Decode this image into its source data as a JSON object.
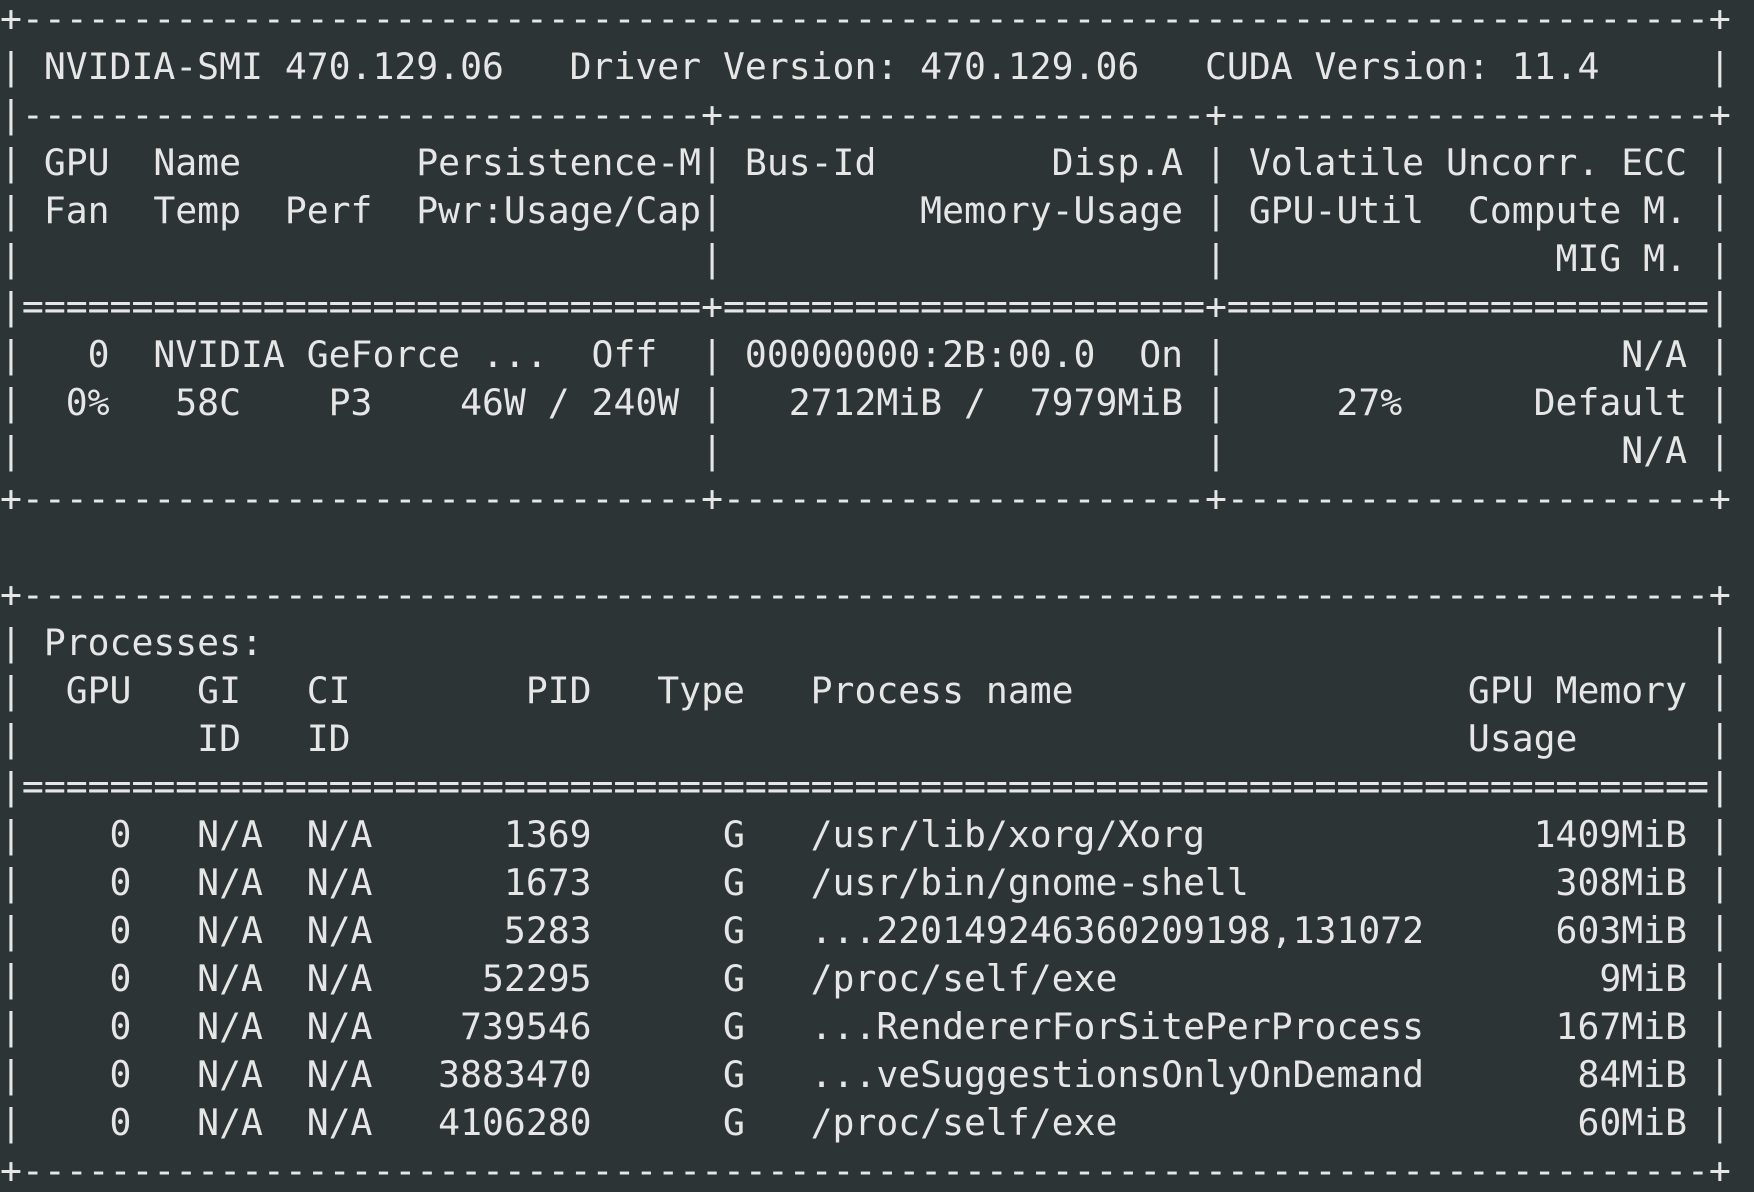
{
  "terminal": {
    "colors": {
      "background": "#2d3436",
      "foreground": "#e6e6e6"
    },
    "header": {
      "border_top": "+-----------------------------------------------------------------------------+",
      "title_line": "| NVIDIA-SMI 470.129.06   Driver Version: 470.129.06   CUDA Version: 11.4     |",
      "divider": "|-------------------------------+----------------------+----------------------+",
      "col_header_1": "| GPU  Name        Persistence-M| Bus-Id        Disp.A | Volatile Uncorr. ECC |",
      "col_header_2": "| Fan  Temp  Perf  Pwr:Usage/Cap|         Memory-Usage | GPU-Util  Compute M. |",
      "col_header_3": "|                               |                      |               MIG M. |",
      "separator": "|===============================+======================+======================|"
    },
    "gpu": {
      "line_1": "|   0  NVIDIA GeForce ...  Off  | 00000000:2B:00.0  On |                  N/A |",
      "line_2": "|  0%   58C    P3    46W / 240W |   2712MiB /  7979MiB |     27%      Default |",
      "line_3": "|                               |                      |                  N/A |",
      "border_bottom": "+-------------------------------+----------------------+----------------------+"
    },
    "blank_line": " ",
    "processes": {
      "border_top": "+-----------------------------------------------------------------------------+",
      "title": "| Processes:                                                                  |",
      "header_1": "|  GPU   GI   CI        PID   Type   Process name                  GPU Memory |",
      "header_2": "|        ID   ID                                                   Usage      |",
      "separator": "|=============================================================================|",
      "rows": [
        "|    0   N/A  N/A      1369      G   /usr/lib/xorg/Xorg               1409MiB |",
        "|    0   N/A  N/A      1673      G   /usr/bin/gnome-shell              308MiB |",
        "|    0   N/A  N/A      5283      G   ...220149246360209198,131072      603MiB |",
        "|    0   N/A  N/A     52295      G   /proc/self/exe                      9MiB |",
        "|    0   N/A  N/A    739546      G   ...RendererForSitePerProcess      167MiB |",
        "|    0   N/A  N/A   3883470      G   ...veSuggestionsOnlyOnDemand       84MiB |",
        "|    0   N/A  N/A   4106280      G   /proc/self/exe                     60MiB |"
      ],
      "border_bottom": "+-----------------------------------------------------------------------------+"
    }
  }
}
